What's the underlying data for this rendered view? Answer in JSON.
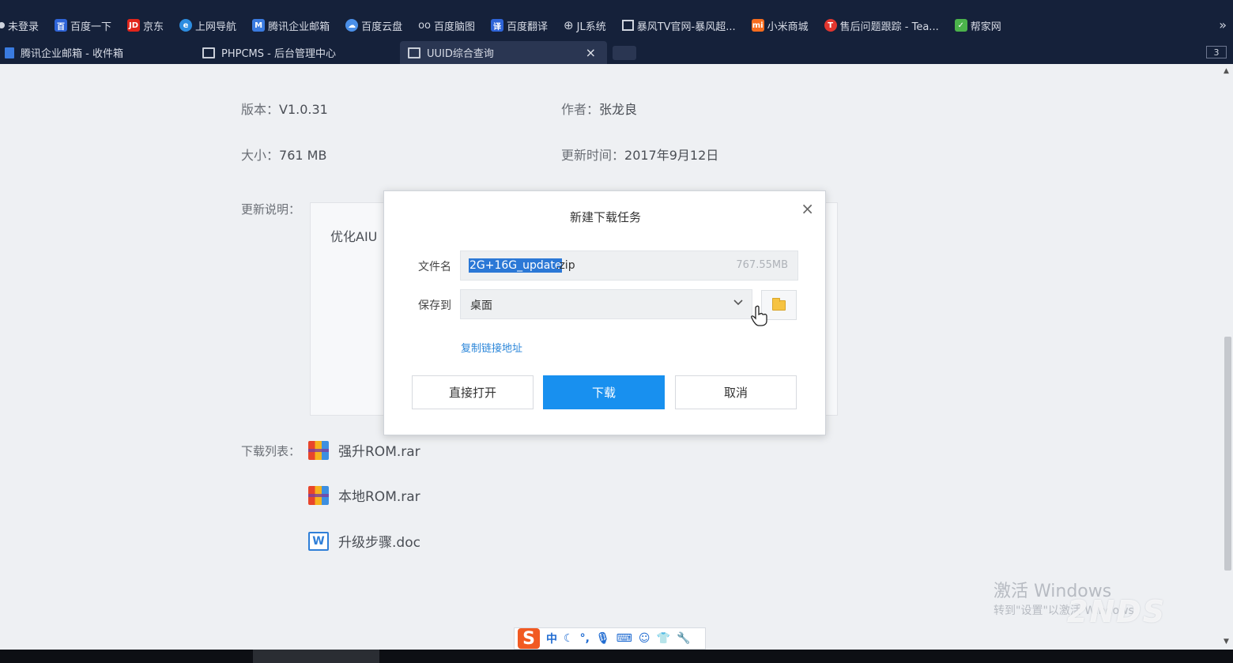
{
  "bookmarks": [
    {
      "label": "未登录",
      "icon": "user-icon",
      "color": "#8fa3c8"
    },
    {
      "label": "百度一下",
      "icon": "baidu-icon",
      "color": "#2e64d8"
    },
    {
      "label": "京东",
      "icon": "jd-icon",
      "color": "#e1251b"
    },
    {
      "label": "上网导航",
      "icon": "ie-icon",
      "color": "#2d8de0"
    },
    {
      "label": "腾讯企业邮箱",
      "icon": "mail-icon",
      "color": "#3a7be0"
    },
    {
      "label": "百度云盘",
      "icon": "cloud-icon",
      "color": "#4a8fe8"
    },
    {
      "label": "百度脑图",
      "icon": "mindmap-icon",
      "color": "#cfd4de"
    },
    {
      "label": "百度翻译",
      "icon": "translate-icon",
      "color": "#2e64d8"
    },
    {
      "label": "JL系统",
      "icon": "globe-icon",
      "color": "#cfd4de"
    },
    {
      "label": "暴风TV官网-暴风超...",
      "icon": "page-icon",
      "color": "#cfd4de"
    },
    {
      "label": "小米商城",
      "icon": "mi-icon",
      "color": "#f66c1e"
    },
    {
      "label": "售后问题跟踪 - Tea...",
      "icon": "teambition-icon",
      "color": "#e2362f"
    },
    {
      "label": "帮家网",
      "icon": "leaf-icon",
      "color": "#4bb34b"
    }
  ],
  "tabs": [
    {
      "label": "腾讯企业邮箱 - 收件箱",
      "active": false
    },
    {
      "label": "PHPCMS - 后台管理中心",
      "active": false
    },
    {
      "label": "UUID综合查询",
      "active": true
    }
  ],
  "tab_close_glyph": "×",
  "tab_count": "3",
  "info": {
    "version_label": "版本：",
    "version_value": "V1.0.31",
    "author_label": "作者：",
    "author_value": "张龙良",
    "size_label": "大小：",
    "size_value": "761 MB",
    "updated_label": "更新时间：",
    "updated_value": "2017年9月12日",
    "notes_label": "更新说明：",
    "notes_text": "优化AIU",
    "downloads_label": "下载列表："
  },
  "downloads": [
    {
      "name": "强升ROM.rar",
      "type": "rar"
    },
    {
      "name": "本地ROM.rar",
      "type": "rar"
    },
    {
      "name": "升级步骤.doc",
      "type": "doc"
    }
  ],
  "dialog": {
    "title": "新建下载任务",
    "close_glyph": "×",
    "filename_label": "文件名",
    "filename_selected": "2G+16G_update",
    "filename_rest": ".zip",
    "filesize": "767.55MB",
    "saveto_label": "保存到",
    "saveto_value": "桌面",
    "copy_link": "复制链接地址",
    "btn_open": "直接打开",
    "btn_download": "下载",
    "btn_cancel": "取消"
  },
  "watermark": {
    "line1": "激活 Windows",
    "line2": "转到\"设置\"以激活 Windows。",
    "logo": "2NDS"
  },
  "ime": {
    "logo": "S",
    "mode": "中"
  }
}
